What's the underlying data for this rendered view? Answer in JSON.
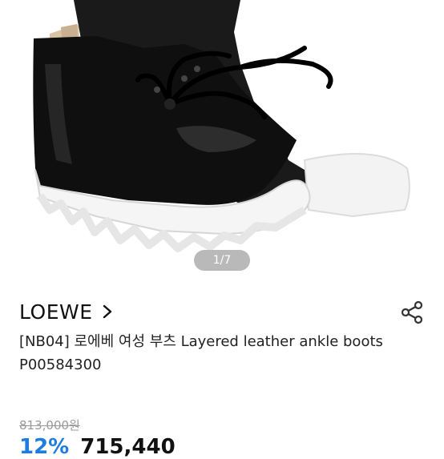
{
  "gallery": {
    "pager_current": "1",
    "pager_total": "7",
    "pager_text": "1/7",
    "image_icon": "black-leather-ankle-boot-photo"
  },
  "product": {
    "brand": "LOEWE",
    "title": "[NB04] 로에베 여성 부츠 Layered leather ankle boots P00584300",
    "original_price": "813,000원",
    "discount_rate": "12%",
    "sale_price": "715,440"
  },
  "icons": {
    "brand_link": "chevron-right-icon",
    "share": "share-icon"
  },
  "colors": {
    "discount": "#1f7ce0",
    "pager_bg": "#b9b9b9"
  }
}
